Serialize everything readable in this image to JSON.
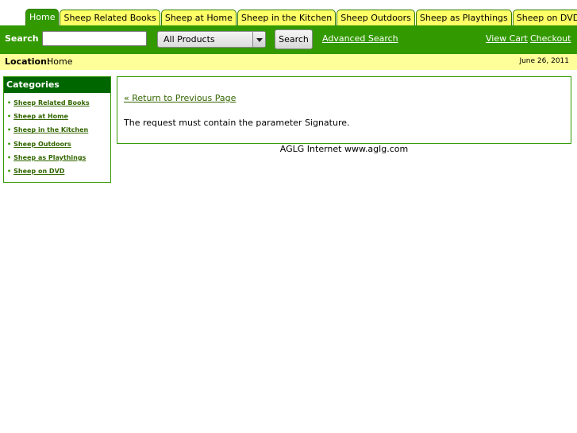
{
  "tabs": [
    {
      "label": "Home",
      "active": true
    },
    {
      "label": "Sheep Related Books",
      "active": false
    },
    {
      "label": "Sheep at Home",
      "active": false
    },
    {
      "label": "Sheep in the Kitchen",
      "active": false
    },
    {
      "label": "Sheep Outdoors",
      "active": false
    },
    {
      "label": "Sheep as Playthings",
      "active": false
    },
    {
      "label": "Sheep on DVD",
      "active": false
    }
  ],
  "search": {
    "label": "Search",
    "input_value": "",
    "select_value": "All Products",
    "button_label": "Search",
    "advanced_label": "Advanced Search"
  },
  "header_links": {
    "view_cart": "View Cart",
    "checkout": "Checkout"
  },
  "location": {
    "label": "Location:",
    "value": "Home",
    "date": "June 26, 2011"
  },
  "categories": {
    "title": "Categories",
    "items": [
      "Sheep Related Books",
      "Sheep at Home",
      "Sheep in the Kitchen",
      "Sheep Outdoors",
      "Sheep as Playthings",
      "Sheep on DVD"
    ]
  },
  "content": {
    "return_link": "« Return to Previous Page",
    "message": "The request must contain the parameter Signature."
  },
  "footer": "AGLG Internet www.aglg.com",
  "colors": {
    "brand_green": "#339900",
    "dark_green": "#006600",
    "tab_yellow": "#ffff66",
    "location_yellow": "#ffff99"
  }
}
